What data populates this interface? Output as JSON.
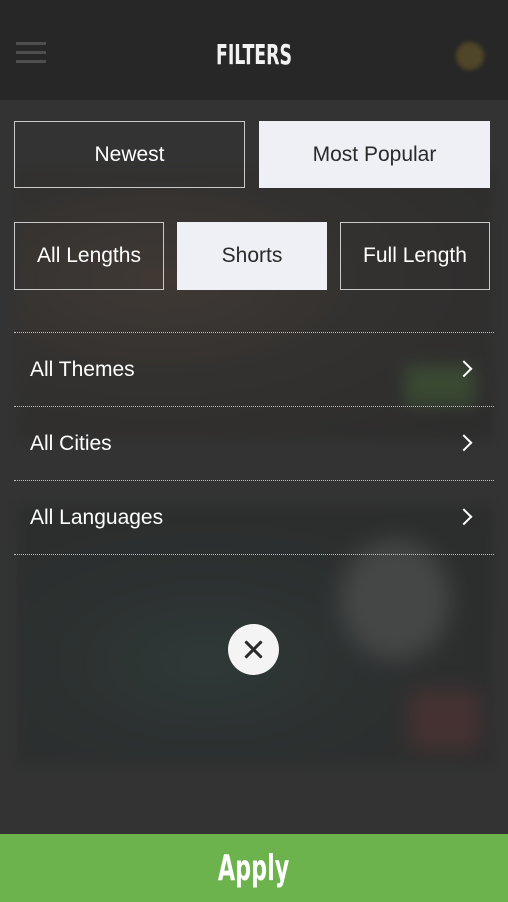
{
  "header": {
    "title": "FILTERS"
  },
  "sort": {
    "options": [
      "Newest",
      "Most Popular"
    ],
    "selected": "Most Popular"
  },
  "length": {
    "options": [
      "All Lengths",
      "Shorts",
      "Full Length"
    ],
    "selected": "Shorts"
  },
  "filters": {
    "items": [
      {
        "label": "All Themes"
      },
      {
        "label": "All Cities"
      },
      {
        "label": "All Languages"
      }
    ]
  },
  "actions": {
    "apply_label": "Apply"
  },
  "icons": {
    "close": "close-icon",
    "chevron": "chevron-right-icon"
  },
  "colors": {
    "apply_bg": "#6db34d",
    "selected_bg": "#eef0f5",
    "overlay": "#2d2d2d"
  }
}
